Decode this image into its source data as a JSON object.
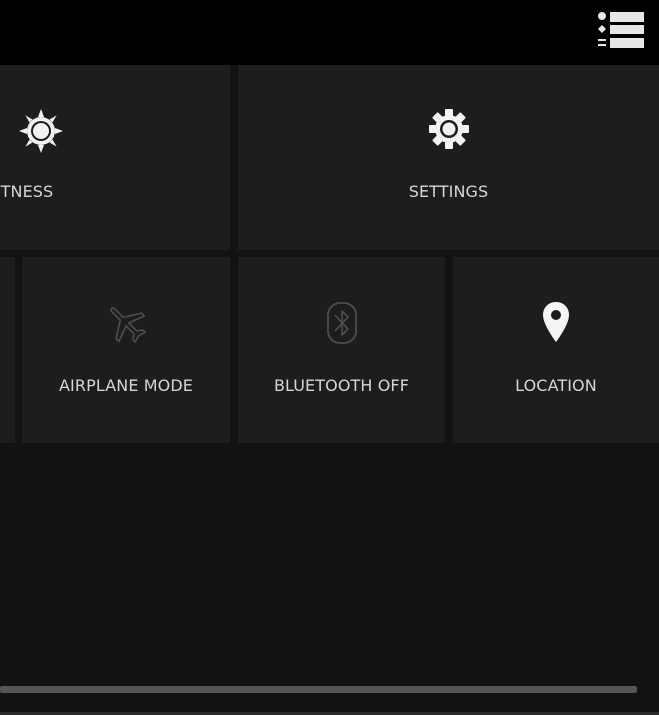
{
  "quick_settings": {
    "row1": [
      {
        "label": "GHTNESS",
        "icon": "sun-icon"
      },
      {
        "label": "SETTINGS",
        "icon": "gear-icon"
      }
    ],
    "row2": [
      {
        "label": "AIRPLANE MODE",
        "icon": "airplane-icon",
        "state": "off"
      },
      {
        "label": "BLUETOOTH OFF",
        "icon": "bluetooth-icon",
        "state": "off"
      },
      {
        "label": "LOCATION",
        "icon": "location-pin-icon",
        "state": "on"
      }
    ]
  },
  "topbar": {
    "icon": "notification-list-icon"
  },
  "colors": {
    "background": "#121212",
    "tile": "#1d1d1d",
    "topbar": "#000000",
    "icon_active": "#f5f5f5",
    "icon_inactive": "#4a4a4a"
  }
}
